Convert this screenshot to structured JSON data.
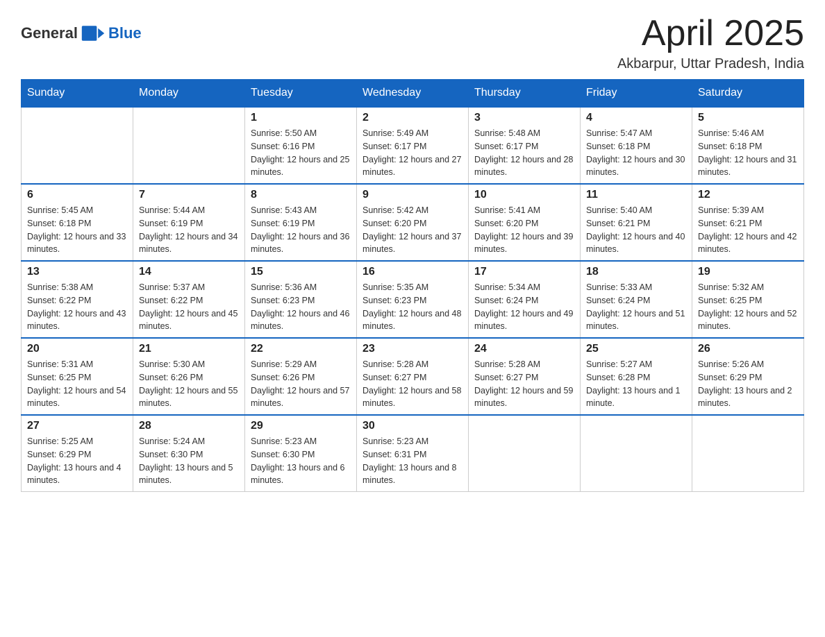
{
  "header": {
    "logo_general": "General",
    "logo_blue": "Blue",
    "month_title": "April 2025",
    "location": "Akbarpur, Uttar Pradesh, India"
  },
  "weekdays": [
    "Sunday",
    "Monday",
    "Tuesday",
    "Wednesday",
    "Thursday",
    "Friday",
    "Saturday"
  ],
  "weeks": [
    [
      null,
      null,
      {
        "day": "1",
        "sunrise": "Sunrise: 5:50 AM",
        "sunset": "Sunset: 6:16 PM",
        "daylight": "Daylight: 12 hours and 25 minutes."
      },
      {
        "day": "2",
        "sunrise": "Sunrise: 5:49 AM",
        "sunset": "Sunset: 6:17 PM",
        "daylight": "Daylight: 12 hours and 27 minutes."
      },
      {
        "day": "3",
        "sunrise": "Sunrise: 5:48 AM",
        "sunset": "Sunset: 6:17 PM",
        "daylight": "Daylight: 12 hours and 28 minutes."
      },
      {
        "day": "4",
        "sunrise": "Sunrise: 5:47 AM",
        "sunset": "Sunset: 6:18 PM",
        "daylight": "Daylight: 12 hours and 30 minutes."
      },
      {
        "day": "5",
        "sunrise": "Sunrise: 5:46 AM",
        "sunset": "Sunset: 6:18 PM",
        "daylight": "Daylight: 12 hours and 31 minutes."
      }
    ],
    [
      {
        "day": "6",
        "sunrise": "Sunrise: 5:45 AM",
        "sunset": "Sunset: 6:18 PM",
        "daylight": "Daylight: 12 hours and 33 minutes."
      },
      {
        "day": "7",
        "sunrise": "Sunrise: 5:44 AM",
        "sunset": "Sunset: 6:19 PM",
        "daylight": "Daylight: 12 hours and 34 minutes."
      },
      {
        "day": "8",
        "sunrise": "Sunrise: 5:43 AM",
        "sunset": "Sunset: 6:19 PM",
        "daylight": "Daylight: 12 hours and 36 minutes."
      },
      {
        "day": "9",
        "sunrise": "Sunrise: 5:42 AM",
        "sunset": "Sunset: 6:20 PM",
        "daylight": "Daylight: 12 hours and 37 minutes."
      },
      {
        "day": "10",
        "sunrise": "Sunrise: 5:41 AM",
        "sunset": "Sunset: 6:20 PM",
        "daylight": "Daylight: 12 hours and 39 minutes."
      },
      {
        "day": "11",
        "sunrise": "Sunrise: 5:40 AM",
        "sunset": "Sunset: 6:21 PM",
        "daylight": "Daylight: 12 hours and 40 minutes."
      },
      {
        "day": "12",
        "sunrise": "Sunrise: 5:39 AM",
        "sunset": "Sunset: 6:21 PM",
        "daylight": "Daylight: 12 hours and 42 minutes."
      }
    ],
    [
      {
        "day": "13",
        "sunrise": "Sunrise: 5:38 AM",
        "sunset": "Sunset: 6:22 PM",
        "daylight": "Daylight: 12 hours and 43 minutes."
      },
      {
        "day": "14",
        "sunrise": "Sunrise: 5:37 AM",
        "sunset": "Sunset: 6:22 PM",
        "daylight": "Daylight: 12 hours and 45 minutes."
      },
      {
        "day": "15",
        "sunrise": "Sunrise: 5:36 AM",
        "sunset": "Sunset: 6:23 PM",
        "daylight": "Daylight: 12 hours and 46 minutes."
      },
      {
        "day": "16",
        "sunrise": "Sunrise: 5:35 AM",
        "sunset": "Sunset: 6:23 PM",
        "daylight": "Daylight: 12 hours and 48 minutes."
      },
      {
        "day": "17",
        "sunrise": "Sunrise: 5:34 AM",
        "sunset": "Sunset: 6:24 PM",
        "daylight": "Daylight: 12 hours and 49 minutes."
      },
      {
        "day": "18",
        "sunrise": "Sunrise: 5:33 AM",
        "sunset": "Sunset: 6:24 PM",
        "daylight": "Daylight: 12 hours and 51 minutes."
      },
      {
        "day": "19",
        "sunrise": "Sunrise: 5:32 AM",
        "sunset": "Sunset: 6:25 PM",
        "daylight": "Daylight: 12 hours and 52 minutes."
      }
    ],
    [
      {
        "day": "20",
        "sunrise": "Sunrise: 5:31 AM",
        "sunset": "Sunset: 6:25 PM",
        "daylight": "Daylight: 12 hours and 54 minutes."
      },
      {
        "day": "21",
        "sunrise": "Sunrise: 5:30 AM",
        "sunset": "Sunset: 6:26 PM",
        "daylight": "Daylight: 12 hours and 55 minutes."
      },
      {
        "day": "22",
        "sunrise": "Sunrise: 5:29 AM",
        "sunset": "Sunset: 6:26 PM",
        "daylight": "Daylight: 12 hours and 57 minutes."
      },
      {
        "day": "23",
        "sunrise": "Sunrise: 5:28 AM",
        "sunset": "Sunset: 6:27 PM",
        "daylight": "Daylight: 12 hours and 58 minutes."
      },
      {
        "day": "24",
        "sunrise": "Sunrise: 5:28 AM",
        "sunset": "Sunset: 6:27 PM",
        "daylight": "Daylight: 12 hours and 59 minutes."
      },
      {
        "day": "25",
        "sunrise": "Sunrise: 5:27 AM",
        "sunset": "Sunset: 6:28 PM",
        "daylight": "Daylight: 13 hours and 1 minute."
      },
      {
        "day": "26",
        "sunrise": "Sunrise: 5:26 AM",
        "sunset": "Sunset: 6:29 PM",
        "daylight": "Daylight: 13 hours and 2 minutes."
      }
    ],
    [
      {
        "day": "27",
        "sunrise": "Sunrise: 5:25 AM",
        "sunset": "Sunset: 6:29 PM",
        "daylight": "Daylight: 13 hours and 4 minutes."
      },
      {
        "day": "28",
        "sunrise": "Sunrise: 5:24 AM",
        "sunset": "Sunset: 6:30 PM",
        "daylight": "Daylight: 13 hours and 5 minutes."
      },
      {
        "day": "29",
        "sunrise": "Sunrise: 5:23 AM",
        "sunset": "Sunset: 6:30 PM",
        "daylight": "Daylight: 13 hours and 6 minutes."
      },
      {
        "day": "30",
        "sunrise": "Sunrise: 5:23 AM",
        "sunset": "Sunset: 6:31 PM",
        "daylight": "Daylight: 13 hours and 8 minutes."
      },
      null,
      null,
      null
    ]
  ]
}
